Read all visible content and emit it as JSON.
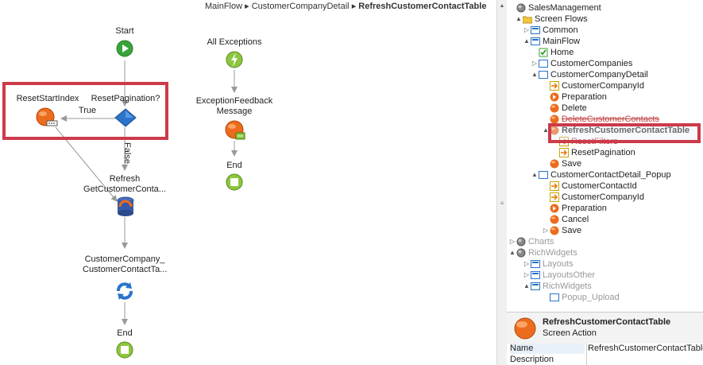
{
  "breadcrumb": {
    "parts": [
      "MainFlow",
      "CustomerCompanyDetail"
    ],
    "current": "RefreshCustomerContactTable",
    "sep": "▸"
  },
  "flow": {
    "start": "Start",
    "reset_pagination": "ResetPagination?",
    "reset_start_index": "ResetStartIndex",
    "true_label": "True",
    "false_label": "False",
    "refresh_line1": "Refresh",
    "refresh_line2": "GetCustomerConta...",
    "assign_line1": "CustomerCompany_",
    "assign_line2": "CustomerContactTa...",
    "end": "End",
    "all_exceptions": "All Exceptions",
    "exc_line1": "ExceptionFeedback",
    "exc_line2": "Message",
    "exc_end": "End"
  },
  "tree": {
    "items": [
      {
        "label": "SalesManagement",
        "icon": "module-icon"
      },
      {
        "label": "Screen Flows",
        "icon": "folder-icon"
      },
      {
        "label": "Common",
        "icon": "flow-icon"
      },
      {
        "label": "MainFlow",
        "icon": "flow-icon"
      },
      {
        "label": "Home",
        "icon": "home-icon"
      },
      {
        "label": "CustomerCompanies",
        "icon": "screen-icon"
      },
      {
        "label": "CustomerCompanyDetail",
        "icon": "screen-icon"
      },
      {
        "label": "CustomerCompanyId",
        "icon": "input-param-icon"
      },
      {
        "label": "Preparation",
        "icon": "preparation-icon"
      },
      {
        "label": "Delete",
        "icon": "action-icon"
      },
      {
        "label": "DeleteCustomerContacts",
        "icon": "action-icon"
      },
      {
        "label": "RefreshCustomerContactTable",
        "icon": "action-icon"
      },
      {
        "label": "ResetFilters",
        "icon": "input-param-icon"
      },
      {
        "label": "ResetPagination",
        "icon": "input-param-icon"
      },
      {
        "label": "Save",
        "icon": "action-icon"
      },
      {
        "label": "CustomerContactDetail_Popup",
        "icon": "screen-icon"
      },
      {
        "label": "CustomerContactId",
        "icon": "input-param-icon"
      },
      {
        "label": "CustomerCompanyId",
        "icon": "input-param-icon"
      },
      {
        "label": "Preparation",
        "icon": "preparation-icon"
      },
      {
        "label": "Cancel",
        "icon": "action-icon"
      },
      {
        "label": "Save",
        "icon": "action-icon"
      },
      {
        "label": "Charts",
        "icon": "module-icon"
      },
      {
        "label": "RichWidgets",
        "icon": "module-icon"
      },
      {
        "label": "Layouts",
        "icon": "flow-icon"
      },
      {
        "label": "LayoutsOther",
        "icon": "flow-icon"
      },
      {
        "label": "RichWidgets",
        "icon": "flow-icon"
      },
      {
        "label": "Popup_Upload",
        "icon": "screen-icon"
      }
    ]
  },
  "props": {
    "title": "RefreshCustomerContactTable",
    "subtitle": "Screen Action",
    "rows": [
      {
        "name": "Name",
        "value": "RefreshCustomerContactTable"
      },
      {
        "name": "Description",
        "value": ""
      }
    ]
  },
  "colors": {
    "highlight": "#cc3b4a",
    "start_green": "#3aa33a",
    "action_orange": "#ec6b1c",
    "decision_blue": "#2a74c9",
    "end_green": "#8cc63f"
  }
}
